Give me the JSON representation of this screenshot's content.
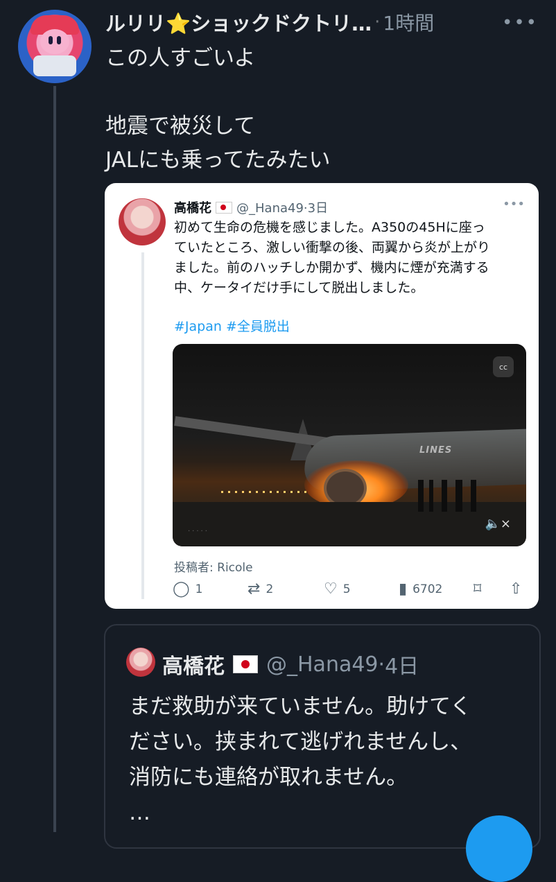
{
  "tweet": {
    "display_name": "ルリリ⭐️ショックドクトリ…",
    "time": "1時間",
    "more_icon": "more-dots-icon",
    "text": "この人すごいよ\n\n地震で被災して\nJALにも乗ってたみたい"
  },
  "embedded": {
    "display_name": "高橋花",
    "handle": "@_Hana49",
    "time": "3日",
    "text": "初めて生命の危機を感じました。A350の45Hに座っ\nていたところ、激しい衝撃の後、両翼から炎が上がり\nました。前のハッチしか開かず、機内に煙が充満する\n中、ケータイだけ手にして脱出しました。",
    "hashtags": "#Japan #全員脱出",
    "media_text": "LINES",
    "poster": "投稿者: Ricole",
    "actions": {
      "replies": "1",
      "reposts": "2",
      "likes": "5",
      "views": "6702"
    }
  },
  "quote": {
    "display_name": "高橋花",
    "handle": "@_Hana49",
    "time": "4日",
    "text": "まだ救助が来ていません。助けてく\nださい。挟まれて逃げれませんし、\n消防にも連絡が取れません。\n…"
  },
  "colors": {
    "background": "#161c25",
    "accent": "#1d9bf0",
    "text": "#e7e9ea",
    "muted": "#8b98a5"
  }
}
